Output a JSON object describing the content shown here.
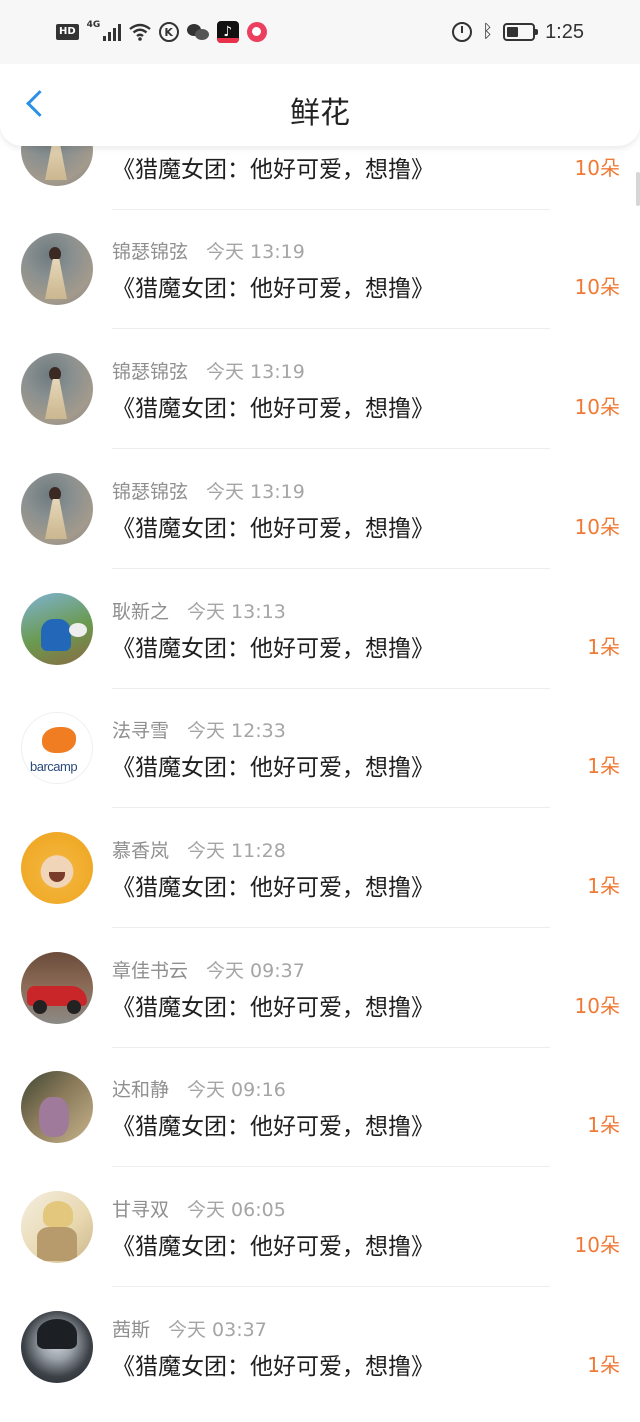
{
  "status_bar": {
    "hd": "HD",
    "network": "4G",
    "k_icon": "K",
    "time": "1:25",
    "left_icons": [
      "hd-icon",
      "signal-icon",
      "wifi-icon",
      "k-circle-icon",
      "wechat-icon",
      "tiktok-icon",
      "app-icon"
    ],
    "right_icons": [
      "alarm-icon",
      "bluetooth-icon",
      "battery-icon"
    ]
  },
  "header": {
    "title": "鲜花",
    "back_icon": "chevron-left-icon",
    "accent_color": "#2b8fe8"
  },
  "colors": {
    "count": "#f07a35",
    "name": "#8f8f8f",
    "message": "#1f1f1f"
  },
  "items": [
    {
      "name": "",
      "time": "",
      "message": "《猎魔女团：他好可爱，想撸》",
      "count": "10朵",
      "avatar": "woman-dress"
    },
    {
      "name": "锦瑟锦弦",
      "time": "今天 13:19",
      "message": "《猎魔女团：他好可爱，想撸》",
      "count": "10朵",
      "avatar": "woman-dress"
    },
    {
      "name": "锦瑟锦弦",
      "time": "今天 13:19",
      "message": "《猎魔女团：他好可爱，想撸》",
      "count": "10朵",
      "avatar": "woman-dress"
    },
    {
      "name": "锦瑟锦弦",
      "time": "今天 13:19",
      "message": "《猎魔女团：他好可爱，想撸》",
      "count": "10朵",
      "avatar": "woman-dress"
    },
    {
      "name": "耿新之",
      "time": "今天 13:13",
      "message": "《猎魔女团：他好可爱，想撸》",
      "count": "1朵",
      "avatar": "boy"
    },
    {
      "name": "法寻雪",
      "time": "今天 12:33",
      "message": "《猎魔女团：他好可爱，想撸》",
      "count": "1朵",
      "avatar": "barcamp",
      "avatar_text": "barcamp"
    },
    {
      "name": "慕香岚",
      "time": "今天 11:28",
      "message": "《猎魔女团：他好可爱，想撸》",
      "count": "1朵",
      "avatar": "yellow-hood"
    },
    {
      "name": "章佳书云",
      "time": "今天 09:37",
      "message": "《猎魔女团：他好可爱，想撸》",
      "count": "10朵",
      "avatar": "red-car"
    },
    {
      "name": "达和静",
      "time": "今天 09:16",
      "message": "《猎魔女团：他好可爱，想撸》",
      "count": "1朵",
      "avatar": "couple"
    },
    {
      "name": "甘寻双",
      "time": "今天 06:05",
      "message": "《猎魔女团：他好可爱，想撸》",
      "count": "10朵",
      "avatar": "anime"
    },
    {
      "name": "茜斯",
      "time": "今天 03:37",
      "message": "《猎魔女团：他好可爱，想撸》",
      "count": "1朵",
      "avatar": "dark-hair"
    }
  ]
}
